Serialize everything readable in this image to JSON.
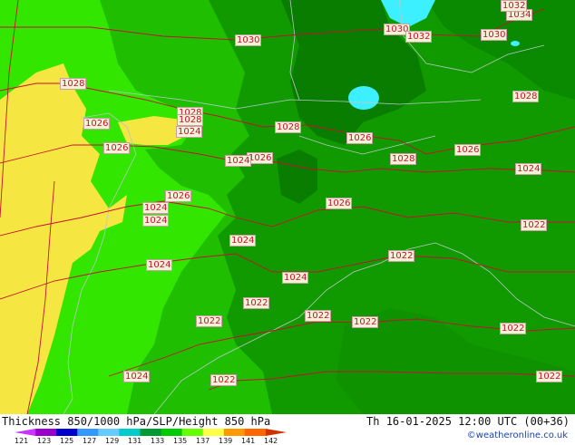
{
  "title": "Thickness 850/1000 hPa/SLP/Height 850 hPa",
  "timestamp": "Th 16-01-2025 12:00 UTC (00+36)",
  "credit": "©weatheronline.co.uk",
  "legend": {
    "values": [
      "121",
      "123",
      "125",
      "127",
      "129",
      "131",
      "133",
      "135",
      "137",
      "139",
      "141",
      "142"
    ],
    "colors": [
      "#cc33ff",
      "#9900cc",
      "#0000cc",
      "#3399ff",
      "#66ccff",
      "#00cccc",
      "#009933",
      "#00cc00",
      "#66ff00",
      "#ffff44",
      "#ff9900",
      "#ff6600",
      "#cc3300"
    ]
  },
  "colors": {
    "yellow": "#f5e642",
    "light_green": "#33e600",
    "green": "#1fbf00",
    "mid_green": "#119a00",
    "dark_green": "#087d00",
    "cyan": "#3df0ff",
    "isobar": "#c8102e"
  },
  "isobars": [
    {
      "text": "1030"
    },
    {
      "text": "1030"
    },
    {
      "text": "1032"
    },
    {
      "text": "1030"
    },
    {
      "text": "1034"
    },
    {
      "text": "1032"
    },
    {
      "text": "1028"
    },
    {
      "text": "1028"
    },
    {
      "text": "1026"
    },
    {
      "text": "1026"
    },
    {
      "text": "1028"
    },
    {
      "text": "1028"
    },
    {
      "text": "1024"
    },
    {
      "text": "1026"
    },
    {
      "text": "1026"
    },
    {
      "text": "1024"
    },
    {
      "text": "1028"
    },
    {
      "text": "1026"
    },
    {
      "text": "1028"
    },
    {
      "text": "1024"
    },
    {
      "text": "1026"
    },
    {
      "text": "1024"
    },
    {
      "text": "1024"
    },
    {
      "text": "1026"
    },
    {
      "text": "1024"
    },
    {
      "text": "1022"
    },
    {
      "text": "1022"
    },
    {
      "text": "1024"
    },
    {
      "text": "1024"
    },
    {
      "text": "1022"
    },
    {
      "text": "1022"
    },
    {
      "text": "1022"
    },
    {
      "text": "1022"
    },
    {
      "text": "1022"
    },
    {
      "text": "1024"
    },
    {
      "text": "1022"
    },
    {
      "text": "1022"
    }
  ]
}
